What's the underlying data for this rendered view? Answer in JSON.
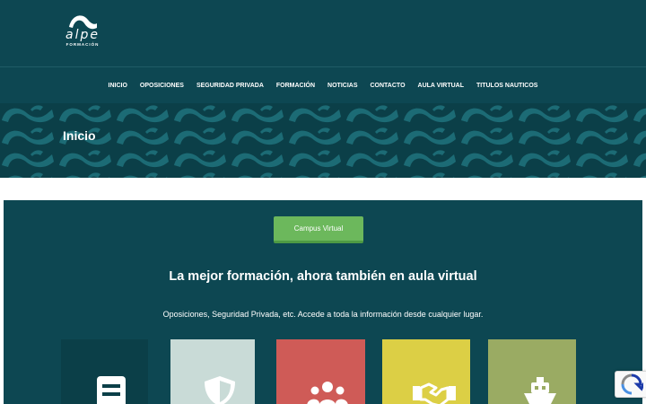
{
  "header": {
    "logo_word": "alpe",
    "logo_sub": "FORMACIÓN",
    "nav": [
      "INICIO",
      "OPOSICIONES",
      "SEGURIDAD PRIVADA",
      "FORMACIÓN",
      "NOTICIAS",
      "CONTACTO",
      "AULA VIRTUAL",
      "TITULOS NAUTICOS"
    ]
  },
  "banner": {
    "title": "Inicio"
  },
  "main": {
    "campus_button": "Campus Virtual",
    "heading": "La mejor formación, ahora también en aula virtual",
    "text": "Oposiciones, Seguridad Privada, etc. Accede a toda la información desde cualquier lugar.",
    "cards": [
      {
        "icon": "document-icon",
        "color": "#0b3f48"
      },
      {
        "icon": "shield-icon",
        "color": "#c9dbd7"
      },
      {
        "icon": "users-icon",
        "color": "#cf5b57"
      },
      {
        "icon": "handshake-icon",
        "color": "#dccf45"
      },
      {
        "icon": "ship-icon",
        "color": "#9aab63"
      }
    ]
  },
  "colors": {
    "header": "#0d4752",
    "accent": "#6cb85c"
  }
}
